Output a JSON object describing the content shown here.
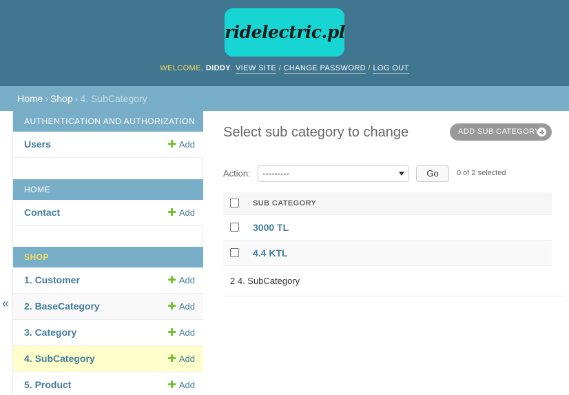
{
  "branding": {
    "logo_text": "ridelectric.pl",
    "logo_color": "#17d5d2"
  },
  "colors": {
    "header_bg": "#417690",
    "breadcrumbs_bg": "#79aec8",
    "link": "#447e9b",
    "add_icon": "#70bf2b",
    "selected_row": "#ffffcc"
  },
  "user_tools": {
    "welcome": "WELCOME,",
    "username": "DIDDY",
    "view_site": "VIEW SITE",
    "change_password": "CHANGE PASSWORD",
    "log_out": "LOG OUT",
    "separator": "/"
  },
  "breadcrumbs": {
    "home": "Home",
    "app": "Shop",
    "current": "4. SubCategory",
    "separator": "›"
  },
  "sidebar": {
    "toggle_label": "«",
    "modules": [
      {
        "caption": "Authentication and Authorization",
        "models": [
          {
            "name": "Users",
            "add_label": "Add"
          }
        ]
      },
      {
        "caption": "Home",
        "models": [
          {
            "name": "Contact",
            "add_label": "Add"
          }
        ]
      },
      {
        "caption": "Shop",
        "current": true,
        "models": [
          {
            "name": "1. Customer",
            "add_label": "Add"
          },
          {
            "name": "2. BaseCategory",
            "add_label": "Add"
          },
          {
            "name": "3. Category",
            "add_label": "Add"
          },
          {
            "name": "4. SubCategory",
            "add_label": "Add",
            "selected": true
          },
          {
            "name": "5. Product",
            "add_label": "Add"
          }
        ]
      }
    ],
    "add_icon": "plus-icon"
  },
  "content": {
    "title": "Select sub category to change",
    "add_button": "ADD SUB CATEGORY",
    "actions": {
      "label": "Action:",
      "selected_option": "---------",
      "go_label": "Go",
      "counter": "0 of 2 selected"
    },
    "table": {
      "column_header": "SUB CATEGORY",
      "rows": [
        {
          "name": "3000 TL"
        },
        {
          "name": "4.4 KTL"
        }
      ]
    },
    "paginator": "2 4. SubCategory"
  }
}
